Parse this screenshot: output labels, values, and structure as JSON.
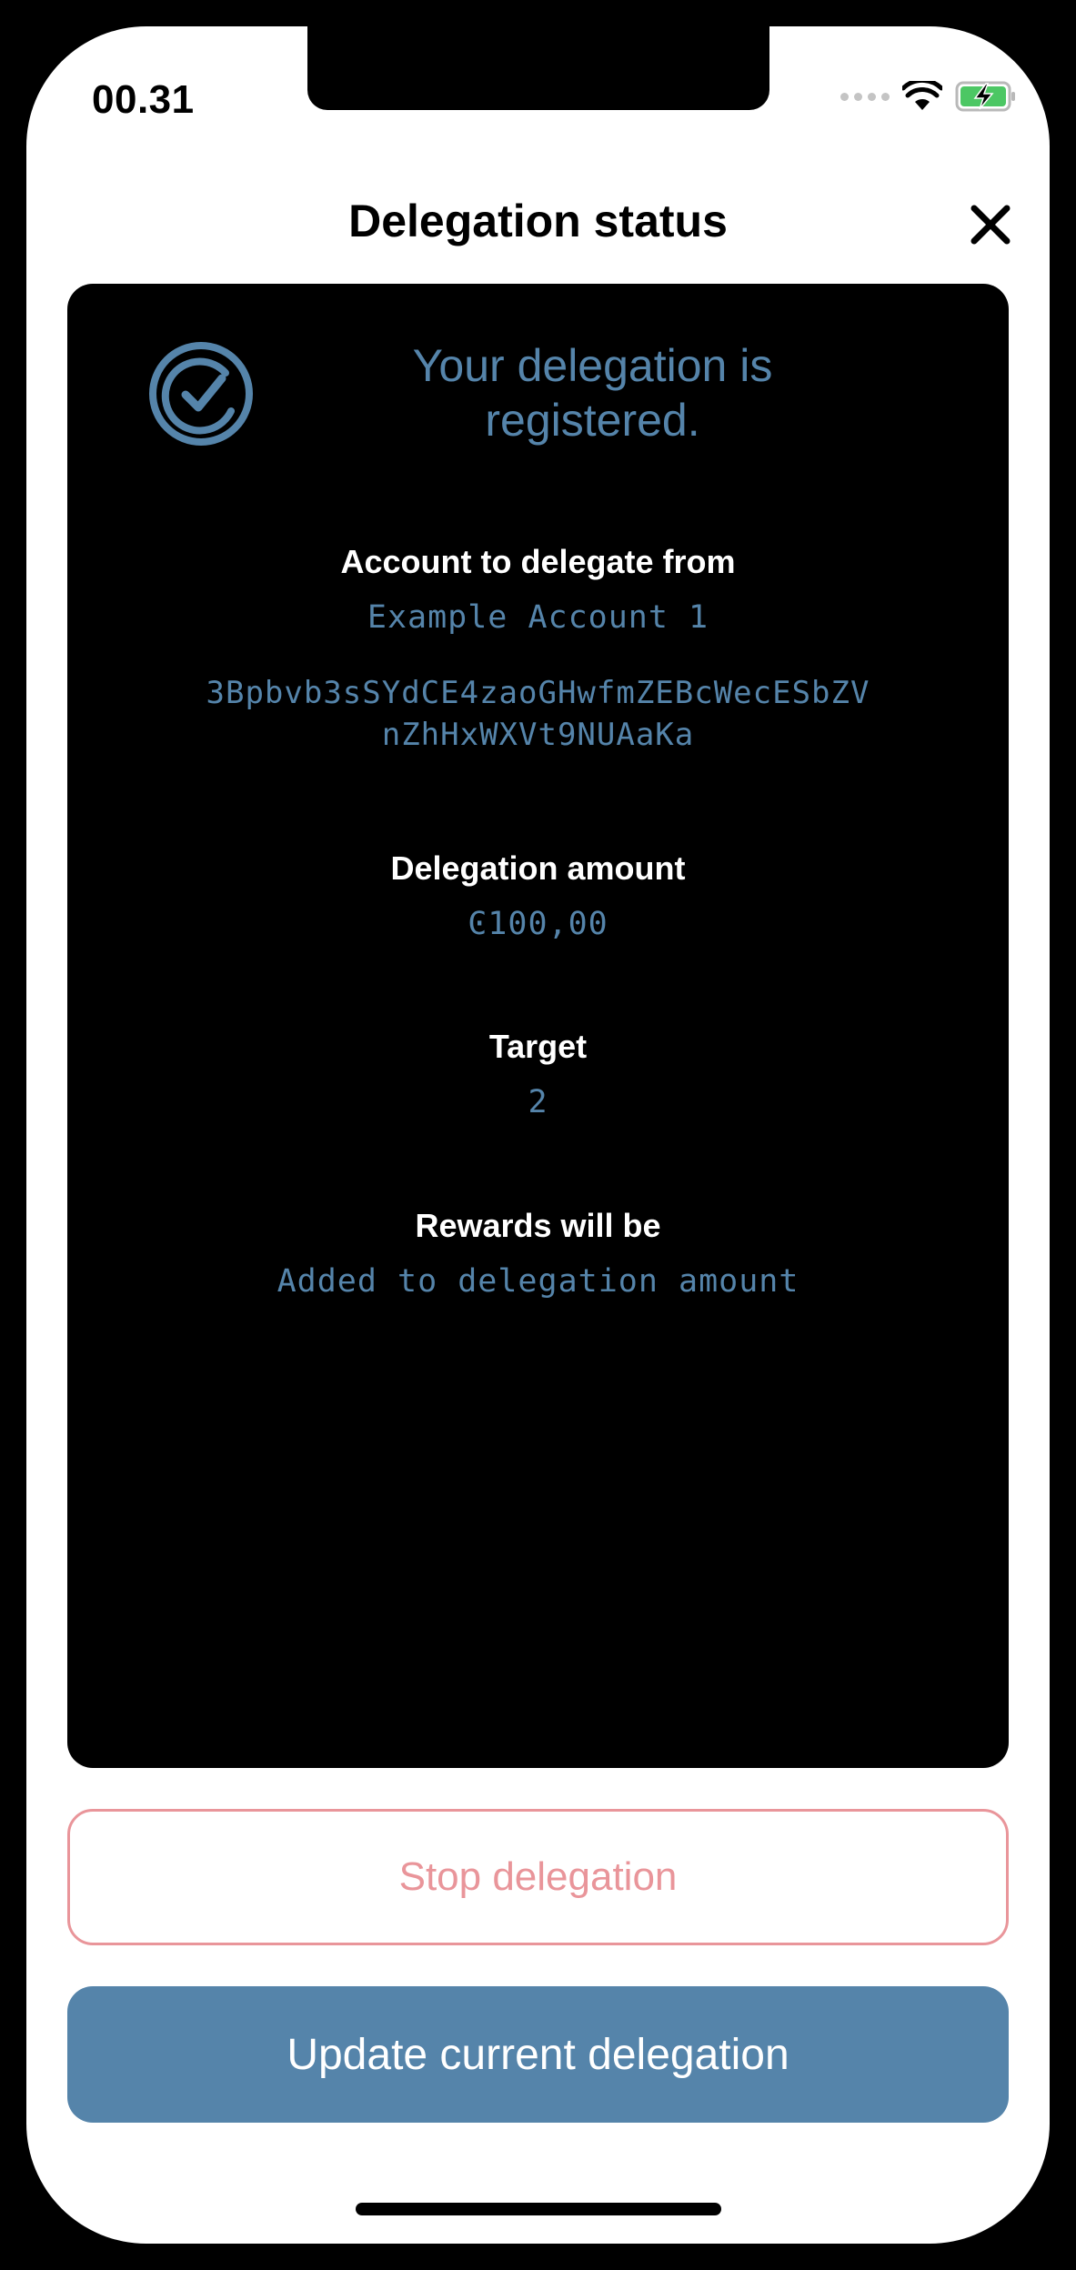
{
  "status_bar": {
    "time": "00.31",
    "icons": [
      "signal-dots-icon",
      "wifi-icon",
      "battery-charging-icon"
    ]
  },
  "header": {
    "title": "Delegation status",
    "close_icon": "close-icon"
  },
  "card": {
    "status_icon": "check-circle-icon",
    "headline_line1": "Your delegation is",
    "headline_line2": "registered.",
    "account_label": "Account to delegate from",
    "account_name": "Example Account 1",
    "account_address_line1": "3Bpbvb3sSYdCE4zaoGHwfmZEBcWecESbZV",
    "account_address_line2": "nZhHxWXVt9NUAaKa",
    "amount_label": "Delegation amount",
    "amount_value": "Ͼ100,00",
    "target_label": "Target",
    "target_value": "2",
    "rewards_label": "Rewards will be",
    "rewards_value": "Added to delegation amount"
  },
  "actions": {
    "stop_label": "Stop delegation",
    "update_label": "Update current delegation"
  },
  "colors": {
    "accent": "#5584aa",
    "danger": "#e9959a",
    "card_bg": "#000000"
  }
}
